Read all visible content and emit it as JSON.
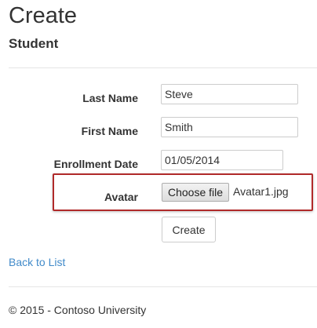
{
  "header": {
    "title": "Create",
    "subtitle": "Student"
  },
  "form": {
    "last_name": {
      "label": "Last Name",
      "value": "Steve"
    },
    "first_name": {
      "label": "First Name",
      "value": "Smith"
    },
    "enrollment_date": {
      "label": "Enrollment Date",
      "value": "01/05/2014"
    },
    "avatar": {
      "label": "Avatar",
      "button_label": "Choose file",
      "file_name": "Avatar1.jpg"
    },
    "submit_label": "Create"
  },
  "nav": {
    "back_link": "Back to List"
  },
  "footer": {
    "text": "© 2015 - Contoso University"
  },
  "colors": {
    "link": "#428bca",
    "highlight_border": "#b02a2a",
    "text": "#333333"
  }
}
